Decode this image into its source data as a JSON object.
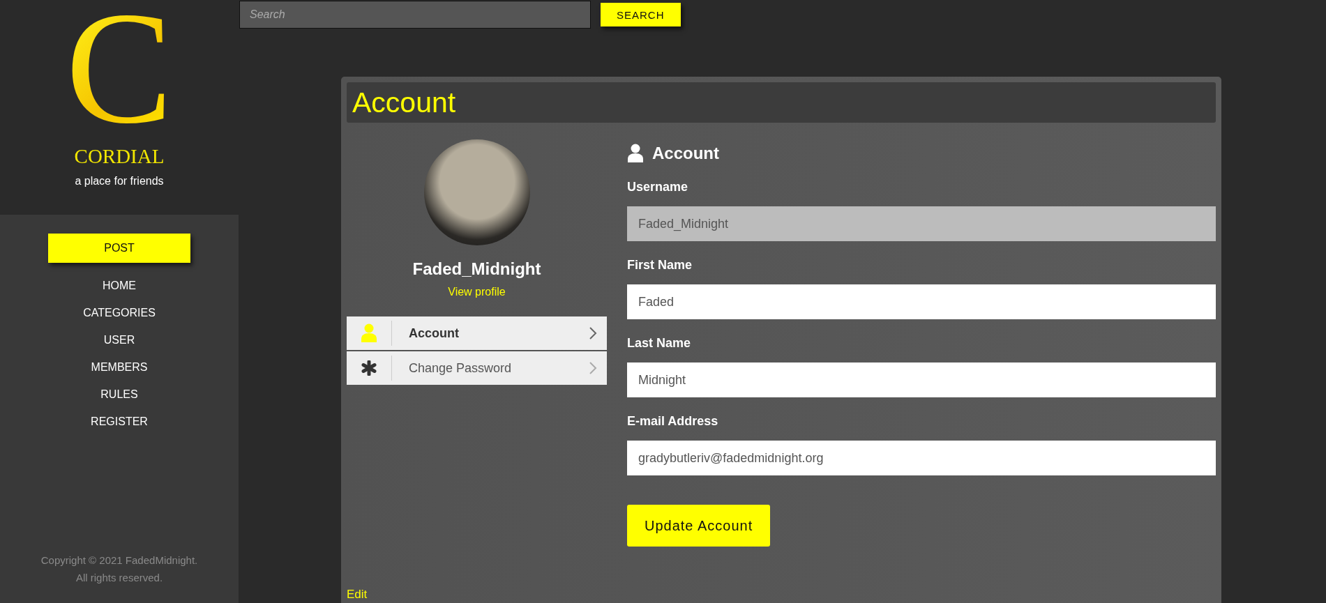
{
  "sidebar": {
    "logo_letter": "C",
    "site_name": "CORDIAL",
    "tagline": "a place for friends",
    "post_button": "POST",
    "nav": [
      "HOME",
      "CATEGORIES",
      "USER",
      "MEMBERS",
      "RULES",
      "REGISTER"
    ],
    "copyright": [
      "Copyright © 2021 FadedMidnight.",
      "All rights reserved."
    ]
  },
  "search": {
    "placeholder": "Search",
    "button": "SEARCH"
  },
  "card": {
    "title": "Account",
    "profile": {
      "username": "Faded_Midnight",
      "link": "View profile"
    },
    "menu": [
      {
        "kind": "user",
        "label": "Account",
        "selected": true
      },
      {
        "kind": "asterisk",
        "label": "Change Password",
        "selected": false
      }
    ],
    "form": {
      "heading": "Account",
      "fields": [
        {
          "label": "Username",
          "value": "Faded_Midnight",
          "disabled": true
        },
        {
          "label": "First Name",
          "value": "Faded",
          "disabled": false
        },
        {
          "label": "Last Name",
          "value": "Midnight",
          "disabled": false
        },
        {
          "label": "E-mail Address",
          "value": "gradybutleriv@fadedmidnight.org",
          "disabled": false
        }
      ],
      "button": "Update Account"
    },
    "footer_link": "Edit"
  }
}
